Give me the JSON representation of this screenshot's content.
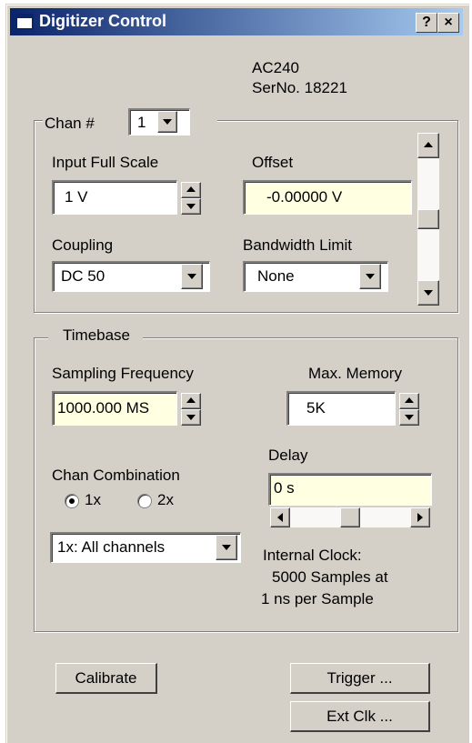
{
  "window": {
    "title": "Digitizer Control",
    "help_label": "?",
    "close_label": "×"
  },
  "device": {
    "model": "AC240",
    "serial": "SerNo. 18221"
  },
  "channel": {
    "label": "Chan #",
    "selected": "1",
    "input_full_scale_label": "Input Full Scale",
    "input_full_scale_value": "1 V",
    "offset_label": "Offset",
    "offset_value": "-0.00000 V",
    "coupling_label": "Coupling",
    "coupling_value": "DC 50",
    "bandwidth_label": "Bandwidth Limit",
    "bandwidth_value": "None",
    "scroll_position": 0.5
  },
  "timebase": {
    "label": "Timebase",
    "sampling_label": "Sampling Frequency",
    "sampling_value": "1000.000 MS",
    "max_memory_label": "Max. Memory",
    "max_memory_value": "5K",
    "delay_label": "Delay",
    "delay_value": "0 s",
    "delay_scroll_position": 0.5,
    "chan_combination_label": "Chan Combination",
    "radio_1x": "1x",
    "radio_2x": "2x",
    "selected_combination": "1x",
    "combination_value": "1x: All channels",
    "clock_line1": "Internal Clock:",
    "clock_line2": "5000 Samples at",
    "clock_line3": "1 ns per Sample"
  },
  "buttons": {
    "calibrate": "Calibrate",
    "trigger": "Trigger ...",
    "ext_clk": "Ext Clk ..."
  },
  "colors": {
    "titlebar_start": "#0a246a",
    "titlebar_end": "#a6caf0",
    "face": "#d4d0c8",
    "highlight_field": "#ffffe1"
  }
}
